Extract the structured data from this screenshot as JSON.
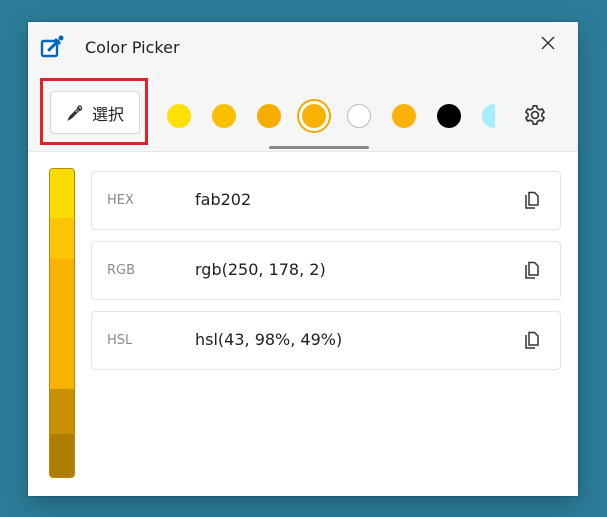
{
  "window": {
    "title": "Color Picker"
  },
  "toolbar": {
    "select_label": "選択"
  },
  "history": [
    {
      "color": "#fee102"
    },
    {
      "color": "#fcc002"
    },
    {
      "color": "#f7ac00"
    },
    {
      "color": "#fab202",
      "selected": true
    },
    {
      "color": "#ffffff"
    },
    {
      "color": "#fbb30a"
    },
    {
      "color": "#000000"
    },
    {
      "color": "#a4eeff"
    }
  ],
  "shades": [
    {
      "color": "#fbdc02"
    },
    {
      "color": "#fcc402"
    },
    {
      "color": "#fab202"
    },
    {
      "color": "#c98f02"
    },
    {
      "color": "#b07d03"
    }
  ],
  "formats": [
    {
      "label": "HEX",
      "value": "fab202"
    },
    {
      "label": "RGB",
      "value": "rgb(250, 178, 2)"
    },
    {
      "label": "HSL",
      "value": "hsl(43, 98%, 49%)"
    }
  ],
  "colors": {
    "accent": "#0067c0",
    "highlight": "#e0202a"
  }
}
